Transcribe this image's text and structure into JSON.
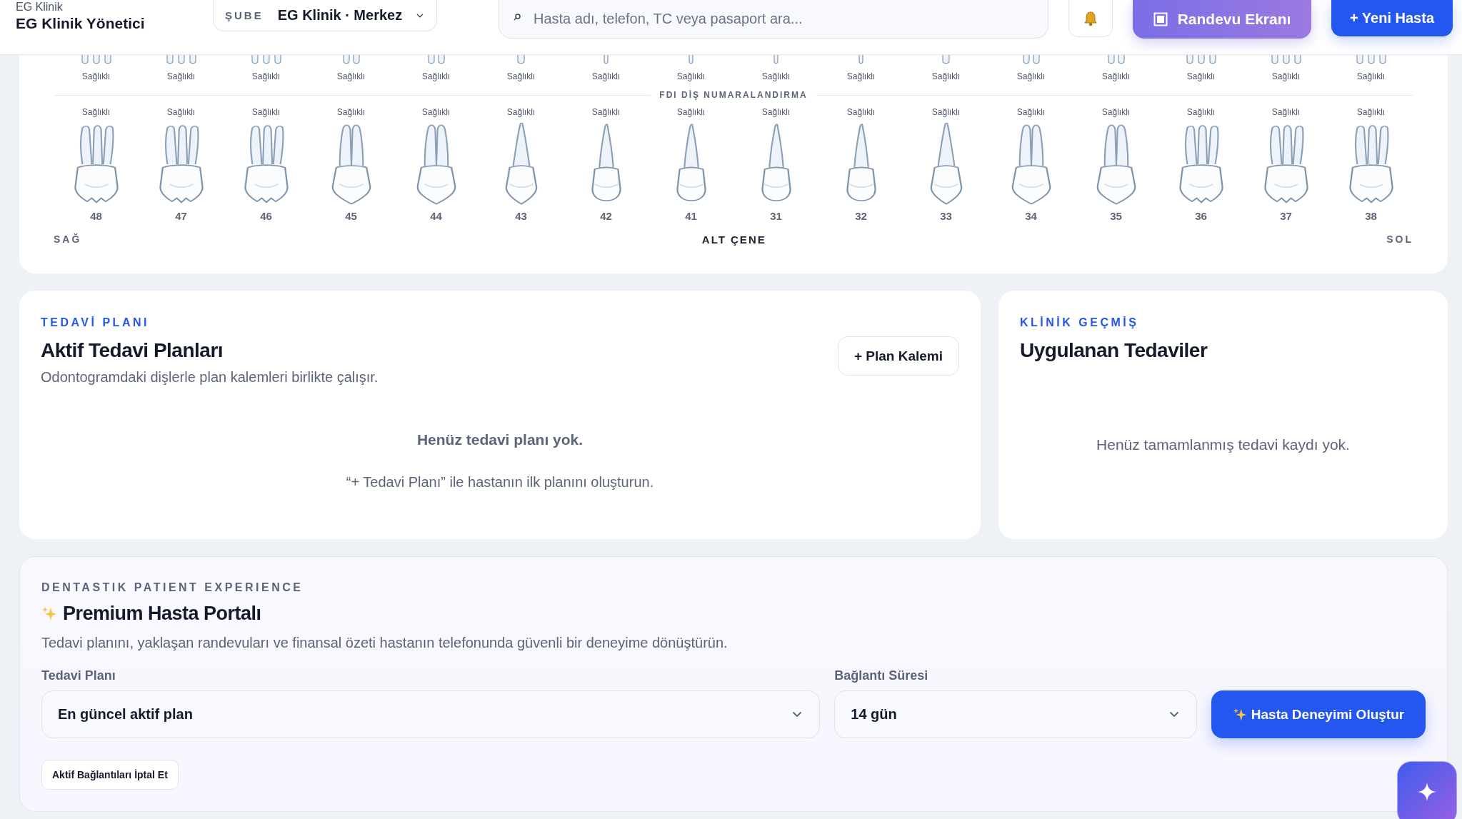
{
  "header": {
    "org": "EG Klinik",
    "user": "EG Klinik Yönetici",
    "branch": {
      "label": "ŞUBE",
      "value": "EG Klinik · Merkez"
    },
    "search": {
      "placeholder": "Hasta adı, telefon, TC veya pasaport ara..."
    },
    "buttons": [
      {
        "kind": "bell"
      },
      {
        "kind": "screen",
        "label": "Randevu Ekranı"
      },
      {
        "kind": "primary",
        "label": "+ Yeni Hasta"
      }
    ]
  },
  "odontogram": {
    "upper_teeth": [
      {
        "kind": "molar",
        "status": "Sağlıklı"
      },
      {
        "kind": "molar",
        "status": "Sağlıklı"
      },
      {
        "kind": "molar",
        "status": "Sağlıklı"
      },
      {
        "kind": "premolar",
        "status": "Sağlıklı"
      },
      {
        "kind": "premolar",
        "status": "Sağlıklı"
      },
      {
        "kind": "canine",
        "status": "Sağlıklı"
      },
      {
        "kind": "incisor",
        "status": "Sağlıklı"
      },
      {
        "kind": "incisor",
        "status": "Sağlıklı"
      },
      {
        "kind": "incisor",
        "status": "Sağlıklı"
      },
      {
        "kind": "incisor",
        "status": "Sağlıklı"
      },
      {
        "kind": "canine",
        "status": "Sağlıklı"
      },
      {
        "kind": "premolar",
        "status": "Sağlıklı"
      },
      {
        "kind": "premolar",
        "status": "Sağlıklı"
      },
      {
        "kind": "molar",
        "status": "Sağlıklı"
      },
      {
        "kind": "molar",
        "status": "Sağlıklı"
      },
      {
        "kind": "molar",
        "status": "Sağlıklı"
      }
    ],
    "divider_title": "FDI DİŞ NUMARALANDIRMA",
    "lower_teeth": [
      {
        "number": "48",
        "kind": "molar",
        "status": "Sağlıklı"
      },
      {
        "number": "47",
        "kind": "molar",
        "status": "Sağlıklı"
      },
      {
        "number": "46",
        "kind": "molar",
        "status": "Sağlıklı"
      },
      {
        "number": "45",
        "kind": "premolar",
        "status": "Sağlıklı"
      },
      {
        "number": "44",
        "kind": "premolar",
        "status": "Sağlıklı"
      },
      {
        "number": "43",
        "kind": "canine",
        "status": "Sağlıklı"
      },
      {
        "number": "42",
        "kind": "incisor",
        "status": "Sağlıklı"
      },
      {
        "number": "41",
        "kind": "incisor",
        "status": "Sağlıklı"
      },
      {
        "number": "31",
        "kind": "incisor",
        "status": "Sağlıklı"
      },
      {
        "number": "32",
        "kind": "incisor",
        "status": "Sağlıklı"
      },
      {
        "number": "33",
        "kind": "canine",
        "status": "Sağlıklı"
      },
      {
        "number": "34",
        "kind": "premolar",
        "status": "Sağlıklı"
      },
      {
        "number": "35",
        "kind": "premolar",
        "status": "Sağlıklı"
      },
      {
        "number": "36",
        "kind": "molar",
        "status": "Sağlıklı"
      },
      {
        "number": "37",
        "kind": "molar",
        "status": "Sağlıklı"
      },
      {
        "number": "38",
        "kind": "molar",
        "status": "Sağlıklı"
      }
    ],
    "side_left": "SAĞ",
    "jaw_label": "ALT ÇENE",
    "side_right": "SOL"
  },
  "treatment_plan": {
    "eyebrow": "TEDAVİ PLANI",
    "title": "Aktif Tedavi Planları",
    "subtitle": "Odontogramdaki dişlerle plan kalemleri birlikte çalışır.",
    "button": "+ Plan Kalemi",
    "empty_title": "Henüz tedavi planı yok.",
    "empty_hint": "“+ Tedavi Planı” ile hastanın ilk planını oluşturun."
  },
  "clinical_history": {
    "eyebrow": "KLİNİK GEÇMİŞ",
    "title": "Uygulanan Tedaviler",
    "empty": "Henüz tamamlanmış tedavi kaydı yok."
  },
  "patient_portal": {
    "eyebrow": "DENTASTIK PATIENT EXPERIENCE",
    "title": "Premium Hasta Portalı",
    "description": "Tedavi planını, yaklaşan randevuları ve finansal özeti hastanın telefonunda güvenli bir deneyime dönüştürün.",
    "plan_field": {
      "label": "Tedavi Planı",
      "value": "En güncel aktif plan"
    },
    "duration_field": {
      "label": "Bağlantı Süresi",
      "value": "14 gün"
    },
    "create_button": "Hasta Deneyimi Oluştur",
    "revoke_button": "Aktif Bağlantıları İptal Et"
  }
}
